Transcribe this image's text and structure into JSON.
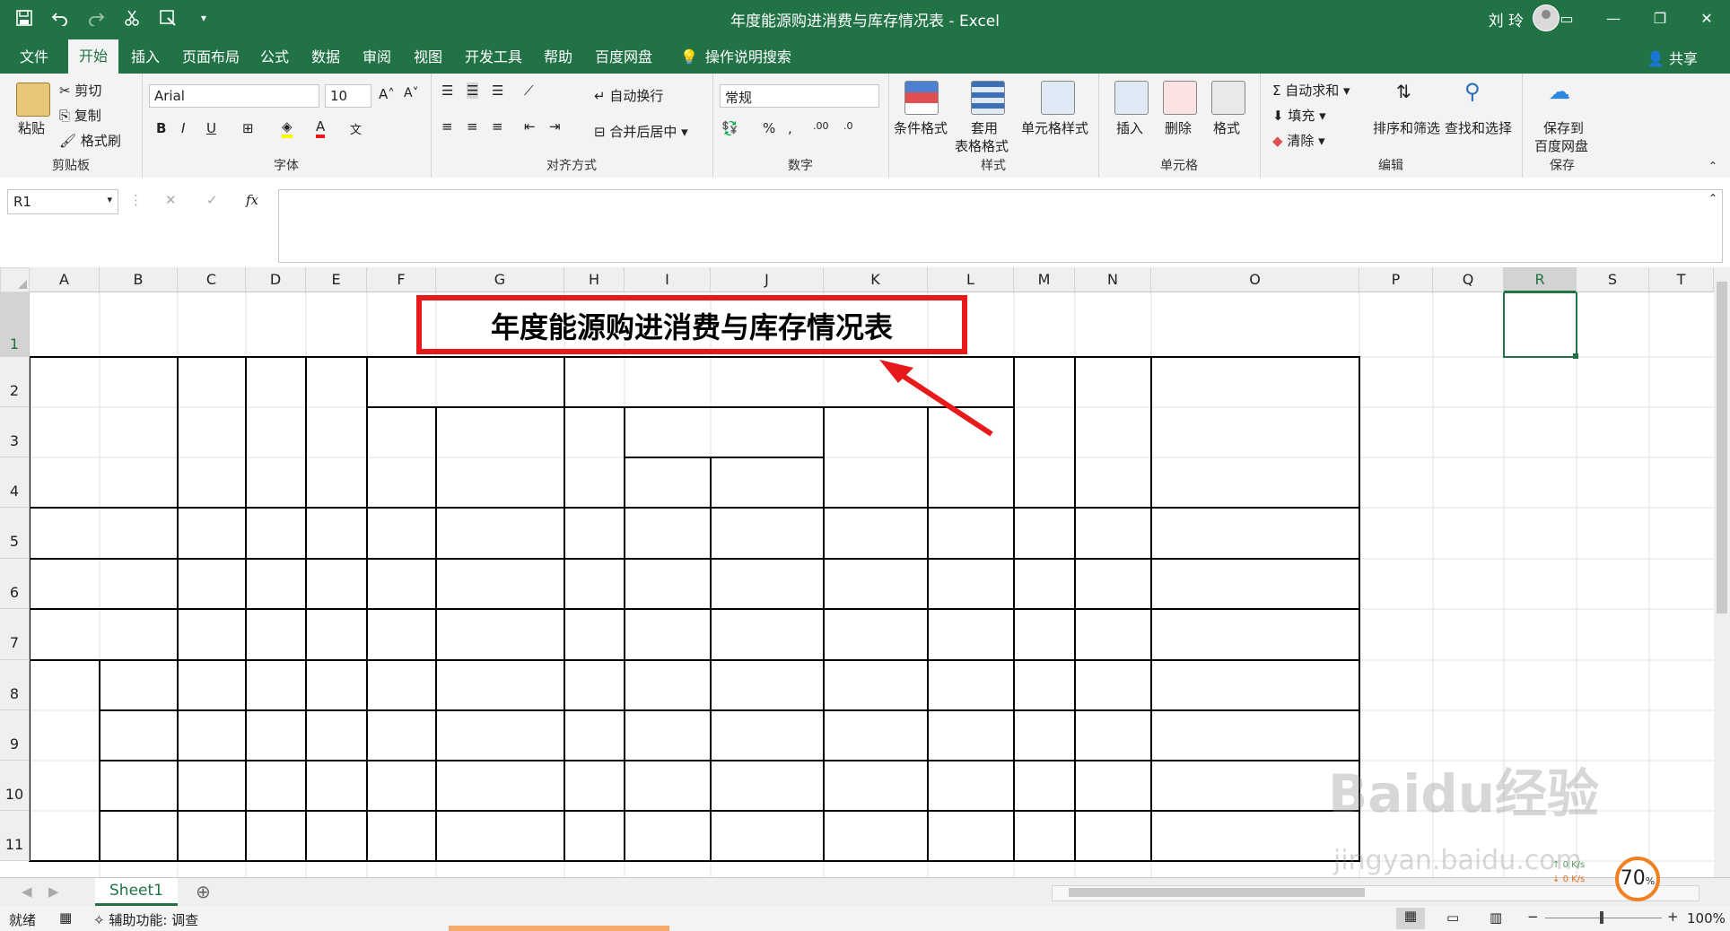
{
  "window": {
    "title": "年度能源购进消费与库存情况表 - Excel",
    "user": "刘 玲"
  },
  "tabs": [
    "文件",
    "开始",
    "插入",
    "页面布局",
    "公式",
    "数据",
    "审阅",
    "视图",
    "开发工具",
    "帮助",
    "百度网盘"
  ],
  "active_tab": "开始",
  "tellme": "操作说明搜索",
  "share": "共享",
  "ribbon": {
    "clipboard": {
      "paste": "粘贴",
      "cut": "剪切",
      "copy": "复制",
      "format_painter": "格式刷",
      "label": "剪贴板"
    },
    "font": {
      "name": "Arial",
      "size": "10",
      "label": "字体"
    },
    "align": {
      "wrap": "自动换行",
      "merge": "合并后居中",
      "label": "对齐方式"
    },
    "number": {
      "format": "常规",
      "label": "数字"
    },
    "styles": {
      "cond": "条件格式",
      "table1": "套用",
      "table2": "表格格式",
      "cell": "单元格样式",
      "label": "样式"
    },
    "cells": {
      "insert": "插入",
      "delete": "删除",
      "format": "格式",
      "label": "单元格"
    },
    "editing": {
      "autosum": "自动求和",
      "fill": "填充",
      "clear": "清除",
      "sort": "排序和筛选",
      "find": "查找和选择",
      "label": "编辑"
    },
    "save": {
      "line1": "保存到",
      "line2": "百度网盘",
      "label": "保存"
    }
  },
  "namebox": "R1",
  "fx": "fx",
  "columns": [
    "A",
    "B",
    "C",
    "D",
    "E",
    "F",
    "G",
    "H",
    "I",
    "J",
    "K",
    "L",
    "M",
    "N",
    "O",
    "P",
    "Q",
    "R",
    "S",
    "T"
  ],
  "rows": [
    "1",
    "2",
    "3",
    "4",
    "5",
    "6",
    "7",
    "8",
    "9",
    "10",
    "11"
  ],
  "cell_title": "年度能源购进消费与库存情况表",
  "sheet": "Sheet1",
  "status": {
    "ready": "就绪",
    "accessibility": "辅助功能: 调查",
    "zoom": "100%"
  },
  "speed": {
    "percent": "70",
    "up": "0",
    "down": "0",
    "unit": "K/s"
  },
  "watermark": {
    "brand": "Baidu经验",
    "url": "jingyan.baidu.com"
  },
  "colors": {
    "excel_green": "#217346",
    "highlight_red": "#e8191a"
  }
}
